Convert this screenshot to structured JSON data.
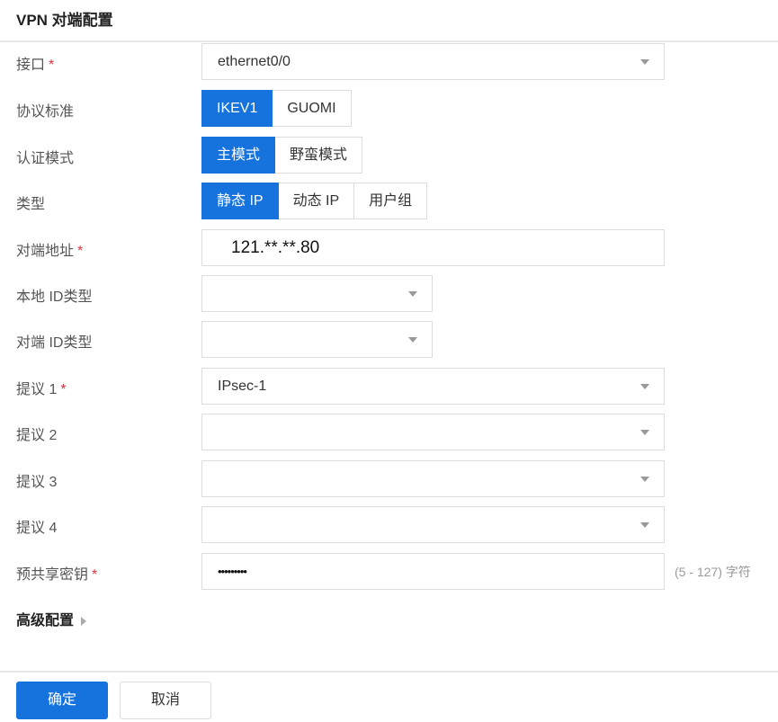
{
  "title": "VPN 对端配置",
  "fields": {
    "interface": {
      "label": "接口",
      "value": "ethernet0/0"
    },
    "protocol": {
      "label": "协议标准",
      "options": [
        "IKEV1",
        "GUOMI"
      ],
      "selected": "IKEV1"
    },
    "auth_mode": {
      "label": "认证模式",
      "options": [
        "主模式",
        "野蛮模式"
      ],
      "selected": "主模式"
    },
    "type": {
      "label": "类型",
      "options": [
        "静态 IP",
        "动态 IP",
        "用户组"
      ],
      "selected": "静态 IP"
    },
    "peer_address": {
      "label": "对端地址",
      "value": "121.**.**.80"
    },
    "local_id_type": {
      "label": "本地 ID类型",
      "value": ""
    },
    "peer_id_type": {
      "label": "对端 ID类型",
      "value": ""
    },
    "proposal1": {
      "label": "提议 1",
      "value": "IPsec-1"
    },
    "proposal2": {
      "label": "提议 2",
      "value": ""
    },
    "proposal3": {
      "label": "提议 3",
      "value": ""
    },
    "proposal4": {
      "label": "提议 4",
      "value": ""
    },
    "psk": {
      "label": "预共享密钥",
      "value": "•••••••••",
      "hint": "(5 - 127) 字符"
    }
  },
  "required_mark": "*",
  "advanced": "高级配置",
  "buttons": {
    "ok": "确定",
    "cancel": "取消"
  },
  "colors": {
    "accent": "#1672dd",
    "required": "#e0323c"
  }
}
